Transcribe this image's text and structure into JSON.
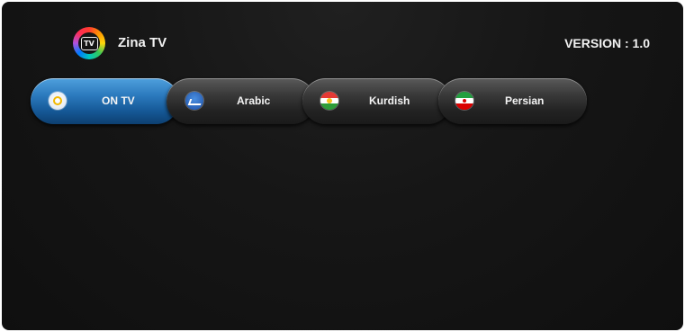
{
  "header": {
    "app_title": "Zina TV",
    "version": "VERSION : 1.0",
    "logo_icon": "tv-logo-icon",
    "logo_text": "TV"
  },
  "tabs": [
    {
      "label": "ON TV",
      "icon": "on-tv-icon",
      "active": true
    },
    {
      "label": "Arabic",
      "icon": "arabic-icon",
      "active": false
    },
    {
      "label": "Kurdish",
      "icon": "kurdish-flag-icon",
      "active": false
    },
    {
      "label": "Persian",
      "icon": "iran-flag-icon",
      "active": false
    }
  ],
  "colors": {
    "background": "#151515",
    "active_tab": "#2b79bd",
    "inactive_tab": "#2e2e2e",
    "text": "#f2f2f2"
  }
}
